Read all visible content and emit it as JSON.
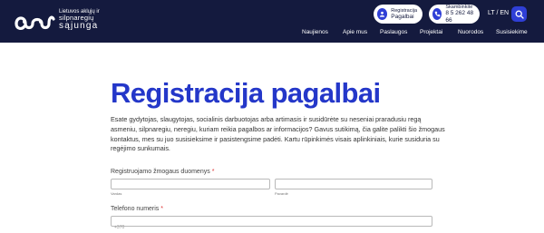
{
  "header": {
    "logo": {
      "line1": "Lietuvos aklųjų ir",
      "line2": "silpnaregių",
      "line3": "sąjunga"
    },
    "register_pill": {
      "label": "Registracija",
      "value": "Pagalbai"
    },
    "call_pill": {
      "label": "Skambinkite",
      "value": "8 5 262 48 66"
    },
    "language": "LT / EN",
    "nav": [
      "Naujienos",
      "Apie mus",
      "Paslaugos",
      "Projektai",
      "Nuorodos",
      "Susisiekime"
    ]
  },
  "main": {
    "title": "Registracija pagalbai",
    "intro": "Esate gydytojas, slaugytojas, socialinis darbuotojas arba artimasis ir susidūrėte su neseniai praradusiu regą asmeniu, silpnaregiu, neregiu, kuriam reikia pagalbos ar informacijos? Gavus sutikimą, čia galite palikti šio žmogaus kontaktus, mes su juo susisieksime ir pasistengsime padėti. Kartu rūpinkimės visais aplinkiniais, kurie susiduria su regėjimo sunkumais."
  },
  "form": {
    "person_label": "Registruojamo žmogaus duomenys",
    "required_mark": "*",
    "first_name_sublabel": "Vardas",
    "last_name_sublabel": "Pavardė",
    "phone_label": "Telefono numeris",
    "phone_placeholder": "+370"
  },
  "colors": {
    "header_bg": "#141a3e",
    "accent": "#2437c9",
    "required": "#dd3333"
  }
}
